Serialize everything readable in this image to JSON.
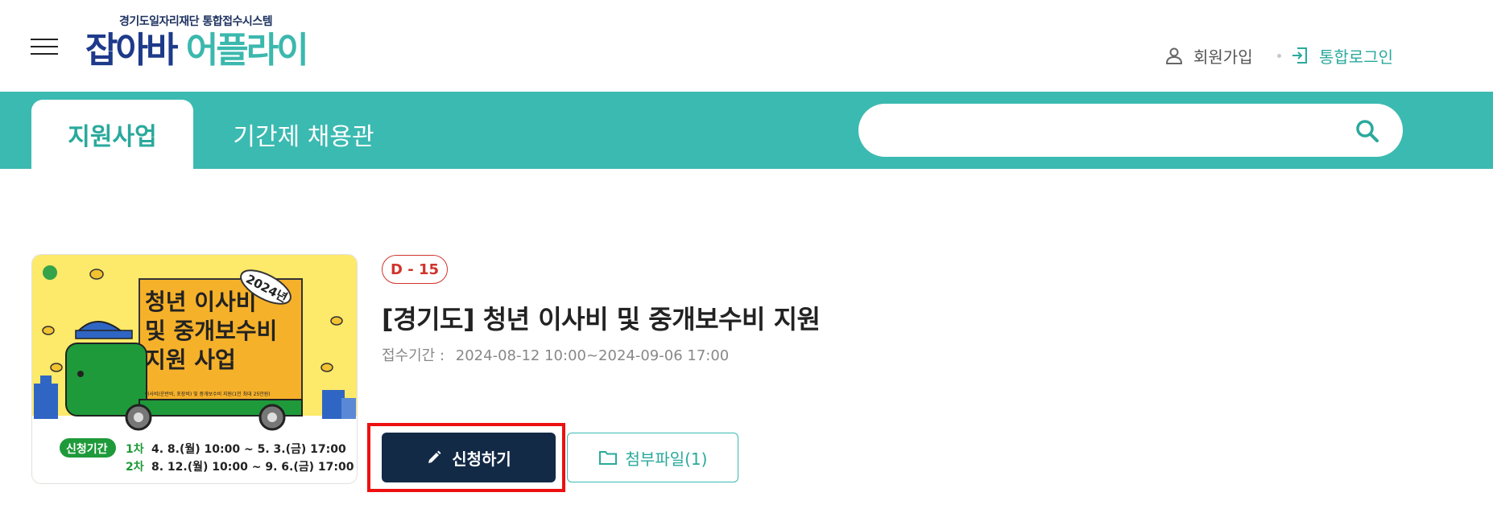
{
  "header": {
    "logo_sub": "경기도일자리재단 통합접수시스템",
    "logo_main_1": "잡아바",
    "logo_main_2": "어플라이",
    "join_label": "회원가입",
    "login_label": "통합로그인"
  },
  "nav": {
    "tabs": [
      {
        "label": "지원사업",
        "active": true
      },
      {
        "label": "기간제 채용관",
        "active": false
      }
    ],
    "search_placeholder": ""
  },
  "program": {
    "dday": "D - 15",
    "title": "[경기도] 청년 이사비 및 중개보수비 지원",
    "period_label": "접수기간 :",
    "period_value": "2024-08-12 10:00~2024-09-06 17:00",
    "apply_label": "신청하기",
    "attach_label": "첨부파일(1)"
  },
  "poster": {
    "year_badge": "2024년",
    "line1": "청년 이사비",
    "line2": "및 중개보수비",
    "line3": "지원 사업",
    "truck_caption": "이사비(운반비, 포장비) 및 중개보수비 지원(1인 최대 25만원)",
    "period_badge": "신청기간",
    "round1_label": "1차",
    "round1_value": "4. 8.(월) 10:00 ~ 5. 3.(금) 17:00",
    "round2_label": "2차",
    "round2_value": "8. 12.(월) 10:00 ~ 9. 6.(금) 17:00"
  },
  "colors": {
    "teal": "#3bbab1",
    "navy": "#122a46",
    "dday_red": "#d0342c",
    "highlight_red": "#ee1010",
    "poster_yellow": "#fde96a",
    "poster_orange": "#f6b12a",
    "poster_green": "#1f9a3a"
  }
}
